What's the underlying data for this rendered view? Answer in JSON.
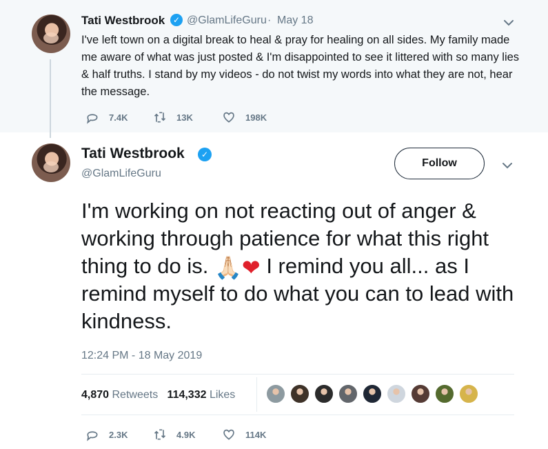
{
  "parent_tweet": {
    "display_name": "Tati Westbrook",
    "handle": "@GlamLifeGuru",
    "date": "May 18",
    "text": "I've left town on a digital break to heal & pray for healing on all sides. My family made me aware of what was just posted & I'm disappointed to see it littered with so many lies & half truths. I stand by my videos - do not twist my words into what they are not, hear the message.",
    "replies": "7.4K",
    "retweets": "13K",
    "likes": "198K"
  },
  "main_tweet": {
    "display_name": "Tati Westbrook",
    "handle": "@GlamLifeGuru",
    "follow_label": "Follow",
    "text_part_1": "I'm working on not reacting out of anger & working through patience for what this right thing to do is.",
    "emoji_1": "🙏🏻",
    "emoji_2": "❤",
    "text_part_2": "I remind you all... as I remind myself to do what you can to lead with kindness.",
    "timestamp": "12:24 PM - 18 May 2019",
    "retweets_count": "4,870",
    "retweets_label": "Retweets",
    "likes_count": "114,332",
    "likes_label": "Likes",
    "replies": "2.3K",
    "retweets": "4.9K",
    "likes": "114K"
  },
  "colors": {
    "accent": "#1da1f2",
    "muted": "#657786",
    "text": "#14171a",
    "parent_background": "#f5f8fa",
    "heart": "#e0202b"
  },
  "icons": {
    "reply": "reply-icon",
    "retweet": "retweet-icon",
    "like": "like-icon",
    "verified": "verified-icon",
    "menu": "chevron-down-icon"
  },
  "likers": [
    {
      "name": "liker-avatar-1",
      "color": "#8d9aa0"
    },
    {
      "name": "liker-avatar-2",
      "color": "#3e3228"
    },
    {
      "name": "liker-avatar-3",
      "color": "#2b2b2b"
    },
    {
      "name": "liker-avatar-4",
      "color": "#62666b"
    },
    {
      "name": "liker-avatar-5",
      "color": "#1f2735"
    },
    {
      "name": "liker-avatar-6",
      "color": "#cfd6de"
    },
    {
      "name": "liker-avatar-7",
      "color": "#553b35"
    },
    {
      "name": "liker-avatar-8",
      "color": "#546a2e"
    },
    {
      "name": "liker-avatar-9",
      "color": "#d6b44b"
    }
  ]
}
